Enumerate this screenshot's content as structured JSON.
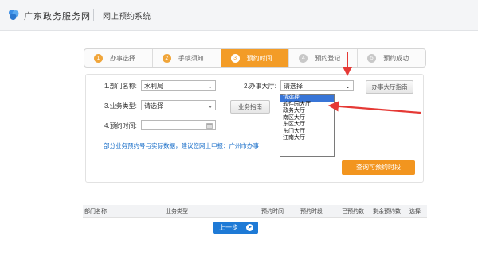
{
  "header": {
    "brand": "广东政务服务网",
    "system": "网上预约系统"
  },
  "steps": [
    {
      "num": "1",
      "label": "办事选择",
      "state": "done"
    },
    {
      "num": "2",
      "label": "手续须知",
      "state": "done"
    },
    {
      "num": "3",
      "label": "预约时间",
      "state": "active"
    },
    {
      "num": "4",
      "label": "预约登记",
      "state": "future"
    },
    {
      "num": "5",
      "label": "预约成功",
      "state": "future"
    }
  ],
  "form": {
    "dept_label": "1.部门名称:",
    "dept_value": "水利局",
    "hall_label": "2.办事大厅:",
    "hall_value": "请选择",
    "hall_guide_btn": "办事大厅指南",
    "type_label": "3.业务类型:",
    "type_value": "请选择",
    "type_guide_btn": "业务指南",
    "time_label": "4.预约时间:",
    "time_value": "",
    "hint": "部分业务预约号与实际数据，建议您网上申报：广州市办事",
    "query_btn": "查询可预约时段"
  },
  "dropdown": {
    "options": [
      "请选择",
      "软件园大厅",
      "政务大厅",
      "南区大厅",
      "东区大厅",
      "东门大厅",
      "江南大厅"
    ],
    "selected_index": 0
  },
  "table": {
    "headers": [
      "部门名称",
      "业务类型",
      "预约时间",
      "预约时段",
      "已预约数",
      "剩余预约数",
      "选择"
    ]
  },
  "pagination": {
    "prev_label": "上一步"
  },
  "colors": {
    "accent_orange": "#f39c27",
    "accent_blue": "#1e7ad6",
    "arrow_red": "#e53935"
  }
}
